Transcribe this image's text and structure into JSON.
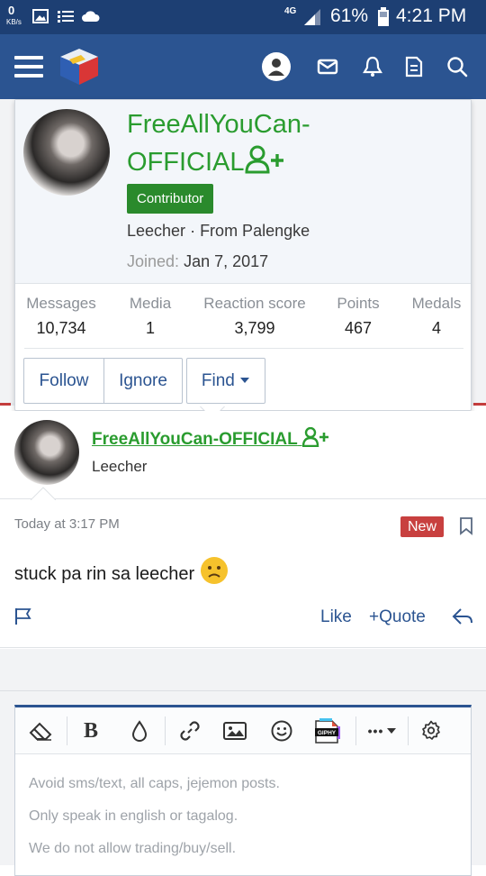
{
  "status_bar": {
    "kbs_value": "0",
    "kbs_unit": "KB/s",
    "network": "4G",
    "battery": "61%",
    "time": "4:21 PM"
  },
  "nav": {
    "icons": [
      "menu-icon",
      "site-logo",
      "profile-icon",
      "inbox-icon",
      "alerts-icon",
      "whats-new-icon",
      "search-icon"
    ]
  },
  "popup": {
    "name": "FreeAllYouCan-OFFICIAL",
    "badge": "Contributor",
    "user_title": "Leecher",
    "location": "From Palengke",
    "title_sep": " · ",
    "joined_label": "Joined:",
    "joined_value": "Jan 7, 2017",
    "stats": [
      {
        "label": "Messages",
        "value": "10,734"
      },
      {
        "label": "Media",
        "value": "1"
      },
      {
        "label": "Reaction score",
        "value": "3,799"
      },
      {
        "label": "Points",
        "value": "467"
      },
      {
        "label": "Medals",
        "value": "4"
      }
    ],
    "buttons": {
      "follow": "Follow",
      "ignore": "Ignore",
      "find": "Find"
    }
  },
  "post": {
    "author": "FreeAllYouCan-OFFICIAL",
    "author_title": "Leecher",
    "time": "Today at 3:17 PM",
    "badge": "New",
    "text": "stuck pa rin sa leecher",
    "actions": {
      "like": "Like",
      "quote": "Quote"
    }
  },
  "editor": {
    "toolbar": [
      "eraser",
      "bold",
      "color",
      "link",
      "image",
      "smilie",
      "giphy",
      "more",
      "settings"
    ],
    "bold_label": "B",
    "giphy_label": "GIPHY",
    "more_label": "•••",
    "placeholder_lines": [
      "Avoid sms/text, all caps, jejemon posts.",
      "Only speak in english or tagalog.",
      "We do not allow trading/buy/sell."
    ]
  },
  "colors": {
    "nav": "#2b5491",
    "status": "#1d3f73",
    "username_green": "#2a9c2f",
    "badge_green": "#2a8a2c",
    "new_red": "#c8403f"
  }
}
